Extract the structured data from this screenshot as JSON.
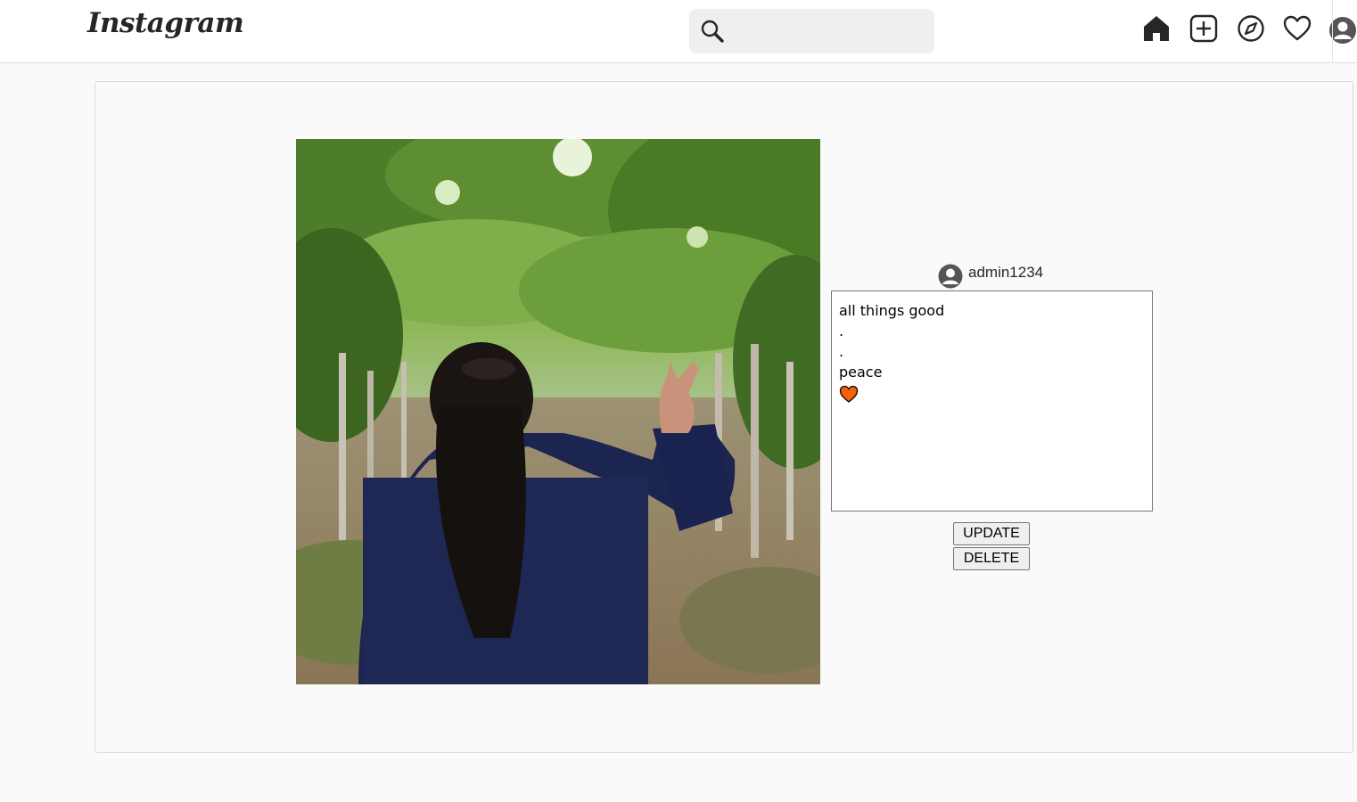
{
  "header": {
    "logo_text": "Instagram",
    "search": {
      "value": "",
      "placeholder": ""
    },
    "nav": [
      {
        "name": "home-icon"
      },
      {
        "name": "new-post-icon"
      },
      {
        "name": "explore-icon"
      },
      {
        "name": "activity-heart-icon"
      },
      {
        "name": "profile-avatar-icon"
      }
    ]
  },
  "post": {
    "image_icon": "photo",
    "author": {
      "username": "admin1234",
      "avatar_icon": "user-avatar-icon"
    },
    "caption_lines": [
      "all things good",
      ".",
      ".",
      "peace"
    ],
    "caption_emoji_icon": "orange-heart-icon",
    "update_label": "UPDATE",
    "delete_label": "DELETE"
  },
  "colors": {
    "header_bg": "#ffffff",
    "page_bg": "#fafafa",
    "border": "#dbdbdb",
    "heart_emoji": "#f4600c"
  }
}
